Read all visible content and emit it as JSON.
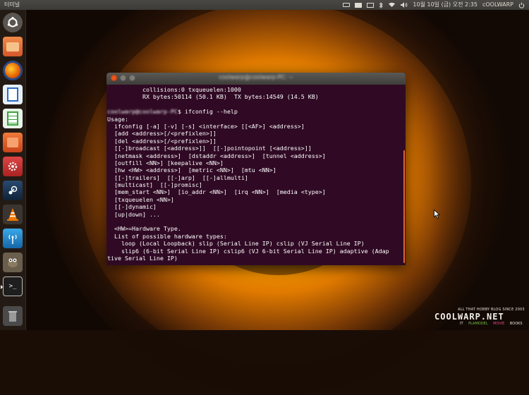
{
  "top_panel": {
    "app_title": "터미널",
    "clock": "10월 10일 (금) 오전 2:35",
    "user": "cOOLWARP",
    "icons": [
      "keyboard-icon",
      "mailbox-icon",
      "mail-icon",
      "bluetooth-icon",
      "wifi-icon",
      "volume-icon",
      "power-icon"
    ]
  },
  "launcher": {
    "items": [
      {
        "name": "ubuntu-dash",
        "glyph": "◉",
        "color": "#5a5550"
      },
      {
        "name": "files",
        "glyph": "",
        "color": "#e8763a"
      },
      {
        "name": "firefox",
        "glyph": "",
        "color": "#e66000"
      },
      {
        "name": "libreoffice-writer",
        "glyph": "",
        "color": "#2a6fc4"
      },
      {
        "name": "libreoffice-calc",
        "glyph": "",
        "color": "#3aa53a"
      },
      {
        "name": "software-center",
        "glyph": "",
        "color": "#e85a1a"
      },
      {
        "name": "system-settings",
        "glyph": "",
        "color": "#c43030"
      },
      {
        "name": "steam",
        "glyph": "",
        "color": "#1e3a5a"
      },
      {
        "name": "vlc",
        "glyph": "",
        "color": "#f07800"
      },
      {
        "name": "network",
        "glyph": "",
        "color": "#1e8fd0"
      },
      {
        "name": "gimp",
        "glyph": "",
        "color": "#7a6a55"
      },
      {
        "name": "terminal",
        "glyph": ">_",
        "color": "#2a2a2a"
      },
      {
        "name": "trash",
        "glyph": "",
        "color": "#5a5a5a"
      }
    ]
  },
  "terminal": {
    "title": "coolwarp@coolwarp-PC: ~",
    "prompt_user": "coolwarp@coolwarp-PC",
    "lines": [
      "          collisions:0 txqueuelen:1000",
      "          RX bytes:50114 (50.1 KB)  TX bytes:14549 (14.5 KB)",
      "",
      "$ ifconfig --help",
      "Usage:",
      "  ifconfig [-a] [-v] [-s] <interface> [[<AF>] <address>]",
      "  [add <address>[/<prefixlen>]]",
      "  [del <address>[/<prefixlen>]]",
      "  [[-]broadcast [<address>]]  [[-]pointopoint [<address>]]",
      "  [netmask <address>]  [dstaddr <address>]  [tunnel <address>]",
      "  [outfill <NN>] [keepalive <NN>]",
      "  [hw <HW> <address>]  [metric <NN>]  [mtu <NN>]",
      "  [[-]trailers]  [[-]arp]  [[-]allmulti]",
      "  [multicast]  [[-]promisc]",
      "  [mem_start <NN>]  [io_addr <NN>]  [irq <NN>]  [media <type>]",
      "  [txqueuelen <NN>]",
      "  [[-]dynamic]",
      "  [up|down] ...",
      "",
      "  <HW>=Hardware Type.",
      "  List of possible hardware types:",
      "    loop (Local Loopback) slip (Serial Line IP) cslip (VJ Serial Line IP)",
      "    slip6 (6-bit Serial Line IP) cslip6 (VJ 6-bit Serial Line IP) adaptive (Adap",
      "tive Serial Line IP)"
    ]
  },
  "watermark": {
    "tagline": "ALL THAT HOBBY BLOG SINCE 2003",
    "logo": "COOLWARP.NET",
    "categories": [
      {
        "label": "IT",
        "color": "#e7e2d6"
      },
      {
        "label": "PLAMODEL",
        "color": "#6fc24a"
      },
      {
        "label": "MOVIE",
        "color": "#e04a8a"
      },
      {
        "label": "BOOKS",
        "color": "#e7e2d6"
      }
    ]
  }
}
